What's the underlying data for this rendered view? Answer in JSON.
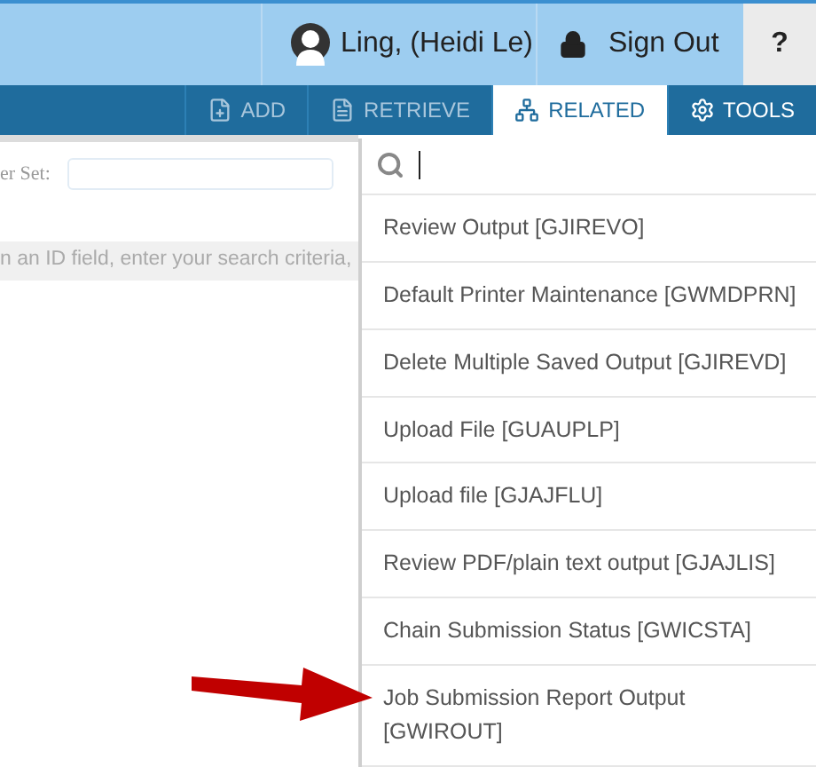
{
  "header": {
    "user": "Ling, (Heidi Le)",
    "sign_out": "Sign Out",
    "help": "?"
  },
  "toolbar": [
    {
      "kind": "add",
      "label": "ADD",
      "selected": false,
      "disabled": true
    },
    {
      "kind": "retrieve",
      "label": "RETRIEVE",
      "selected": false,
      "disabled": true
    },
    {
      "kind": "related",
      "label": "RELATED",
      "selected": true,
      "disabled": false
    },
    {
      "kind": "tools",
      "label": "TOOLS",
      "selected": false,
      "disabled": false
    }
  ],
  "form": {
    "label": "er Set:",
    "hint": "n an ID field, enter your search criteria,"
  },
  "related_menu": {
    "items": [
      "Review Output [GJIREVO]",
      "Default Printer Maintenance [GWMDPRN]",
      "Delete Multiple Saved Output [GJIREVD]",
      "Upload File [GUAUPLP]",
      "Upload file [GJAJFLU]",
      "Review PDF/plain text output [GJAJLIS]",
      "Chain Submission Status [GWICSTA]",
      "Job Submission Report Output [GWIROUT]"
    ]
  }
}
